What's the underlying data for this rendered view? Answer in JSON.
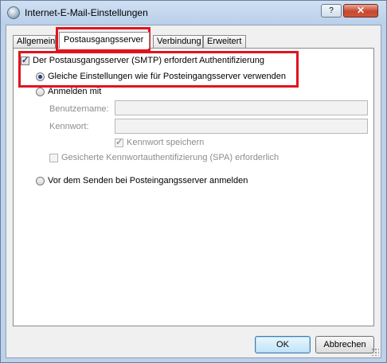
{
  "window": {
    "title": "Internet-E-Mail-Einstellungen",
    "help_button": "?",
    "close_button": "✕"
  },
  "tabs": [
    {
      "label": "Allgemein",
      "active": false
    },
    {
      "label": "Postausgangsserver",
      "active": true
    },
    {
      "label": "Verbindung",
      "active": false
    },
    {
      "label": "Erweitert",
      "active": false
    }
  ],
  "outgoing": {
    "smtp_auth_label": "Der Postausgangsserver (SMTP) erfordert Authentifizierung",
    "smtp_auth_checked": true,
    "same_settings_label": "Gleiche Einstellungen wie für Posteingangsserver verwenden",
    "same_settings_selected": true,
    "login_label": "Anmelden mit",
    "username_label": "Benutzername:",
    "username_value": "",
    "password_label": "Kennwort:",
    "password_value": "",
    "remember_password_label": "Kennwort speichern",
    "remember_password_checked": true,
    "spa_label": "Gesicherte Kennwortauthentifizierung (SPA) erforderlich",
    "spa_checked": false,
    "pop_before_smtp_label": "Vor dem Senden bei Posteingangsserver anmelden"
  },
  "buttons": {
    "ok": "OK",
    "cancel": "Abbrechen"
  },
  "colors": {
    "highlight": "#e0141e",
    "title_bar": "#bcd1ea"
  }
}
